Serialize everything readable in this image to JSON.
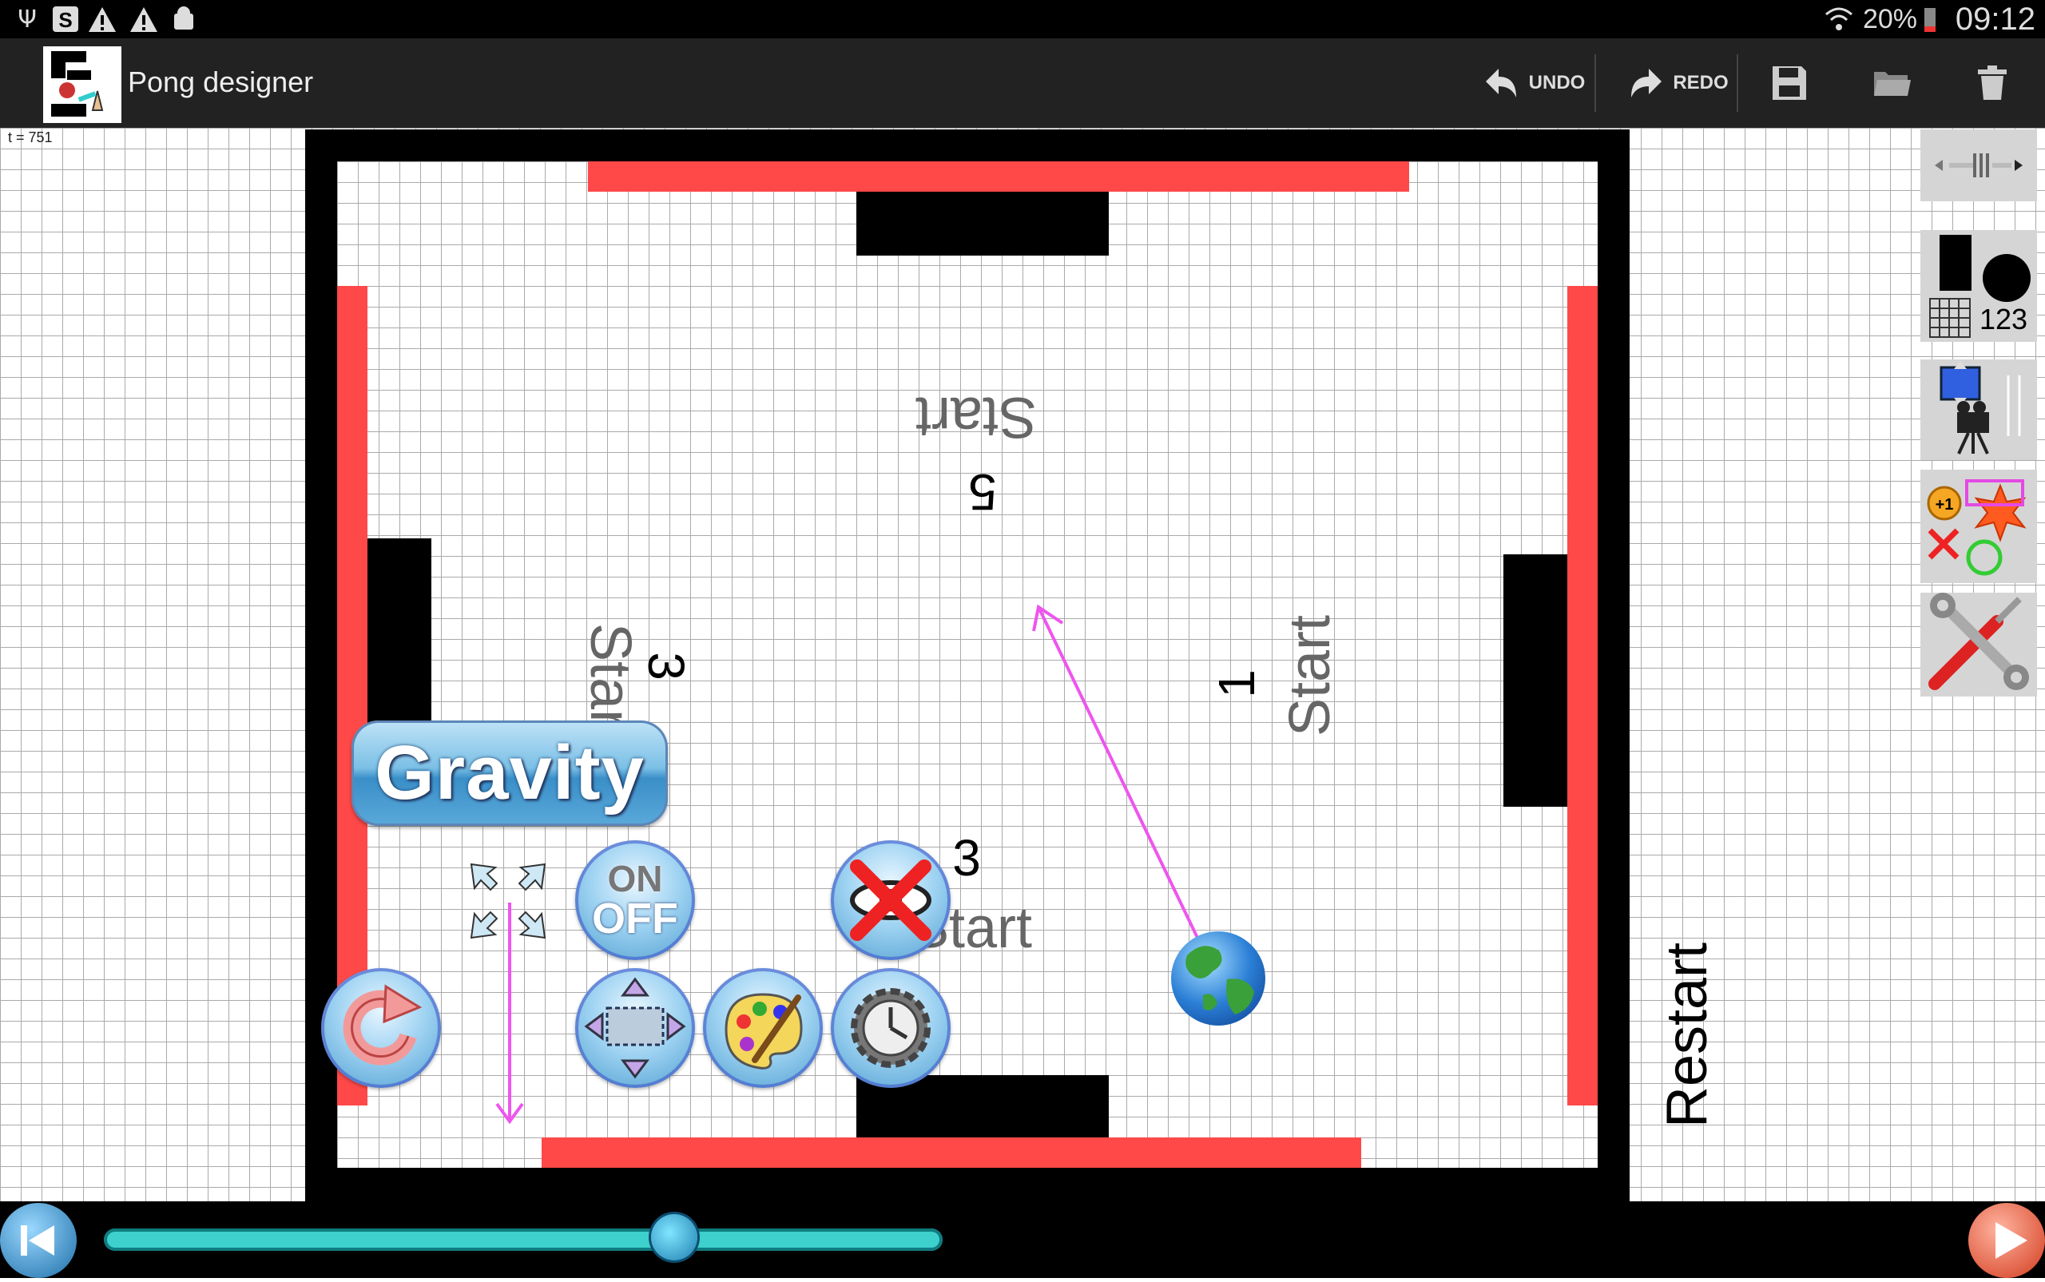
{
  "status_bar": {
    "battery": "20%",
    "time": "09:12",
    "icons": [
      "usb-icon",
      "sync-icon",
      "warning-icon",
      "warning-icon",
      "android-debug-icon",
      "wifi-icon",
      "battery-icon"
    ]
  },
  "action_bar": {
    "title": "Pong designer",
    "undo_label": "UNDO",
    "redo_label": "REDO",
    "save_icon": "save-icon",
    "open_icon": "folder-icon",
    "delete_icon": "trash-icon"
  },
  "canvas": {
    "time_label": "t = 751",
    "texts": {
      "start_top": "Start",
      "score_top": "5",
      "score_left": "3",
      "start_left": "Start",
      "score_right": "1",
      "start_right": "Start",
      "score_bottom": "3",
      "start_bottom": "Start",
      "restart": "Restart"
    },
    "gravity_label": "Gravity",
    "onoff": {
      "on": "ON",
      "off": "OFF"
    },
    "colors": {
      "wall": "#ff4848",
      "paddle": "#000000",
      "arrow": "#ee55ee"
    }
  },
  "toolbox": {
    "tiles": [
      "scroll-handle",
      "shapes-tool",
      "camera-move-tool",
      "rules-tool",
      "settings-tool"
    ],
    "shapes_label": "123",
    "rules_badge": "+1"
  },
  "bottom_bar": {
    "progress_percent": 68
  }
}
